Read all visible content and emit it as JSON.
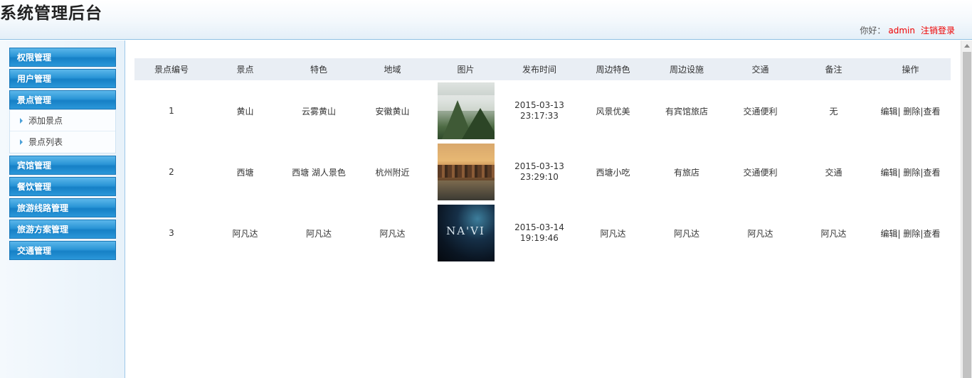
{
  "header": {
    "site_title": "系统管理后台",
    "greeting": "你好：",
    "username": "admin",
    "logout": "注销登录"
  },
  "sidebar": {
    "groups": [
      {
        "label": "权限管理"
      },
      {
        "label": "用户管理"
      },
      {
        "label": "景点管理",
        "expanded": true,
        "items": [
          {
            "label": "添加景点"
          },
          {
            "label": "景点列表"
          }
        ]
      },
      {
        "label": "宾馆管理"
      },
      {
        "label": "餐饮管理"
      },
      {
        "label": "旅游线路管理"
      },
      {
        "label": "旅游方案管理"
      },
      {
        "label": "交通管理"
      }
    ]
  },
  "table": {
    "columns": [
      "景点编号",
      "景点",
      "特色",
      "地域",
      "图片",
      "发布时间",
      "周边特色",
      "周边设施",
      "交通",
      "备注",
      "操作"
    ],
    "rows": [
      {
        "id": "1",
        "name": "黄山",
        "feature": "云雾黄山",
        "region": "安徽黄山",
        "image": "mountain",
        "date": "2015-03-13",
        "time": "23:17:33",
        "nearby_feature": "风景优美",
        "facility": "有宾馆旅店",
        "traffic": "交通便利",
        "remark": "无"
      },
      {
        "id": "2",
        "name": "西塘",
        "feature": "西塘 湖人景色",
        "region": "杭州附近",
        "image": "water-town",
        "date": "2015-03-13",
        "time": "23:29:10",
        "nearby_feature": "西塘小吃",
        "facility": "有旅店",
        "traffic": "交通便利",
        "remark": "交通"
      },
      {
        "id": "3",
        "name": "阿凡达",
        "feature": "阿凡达",
        "region": "阿凡达",
        "image": "navi-poster",
        "image_text": "NA'VI",
        "date": "2015-03-14",
        "time": "19:19:46",
        "nearby_feature": "阿凡达",
        "facility": "阿凡达",
        "traffic": "阿凡达",
        "remark": "阿凡达"
      }
    ],
    "actions": {
      "edit": "编辑",
      "delete": "删除",
      "view": "查看"
    }
  },
  "colors": {
    "menu_blue": "#2a95d6",
    "header_border": "#8fc1e3",
    "table_header_bg": "#e9eef4",
    "user_red": "#ee0000"
  }
}
